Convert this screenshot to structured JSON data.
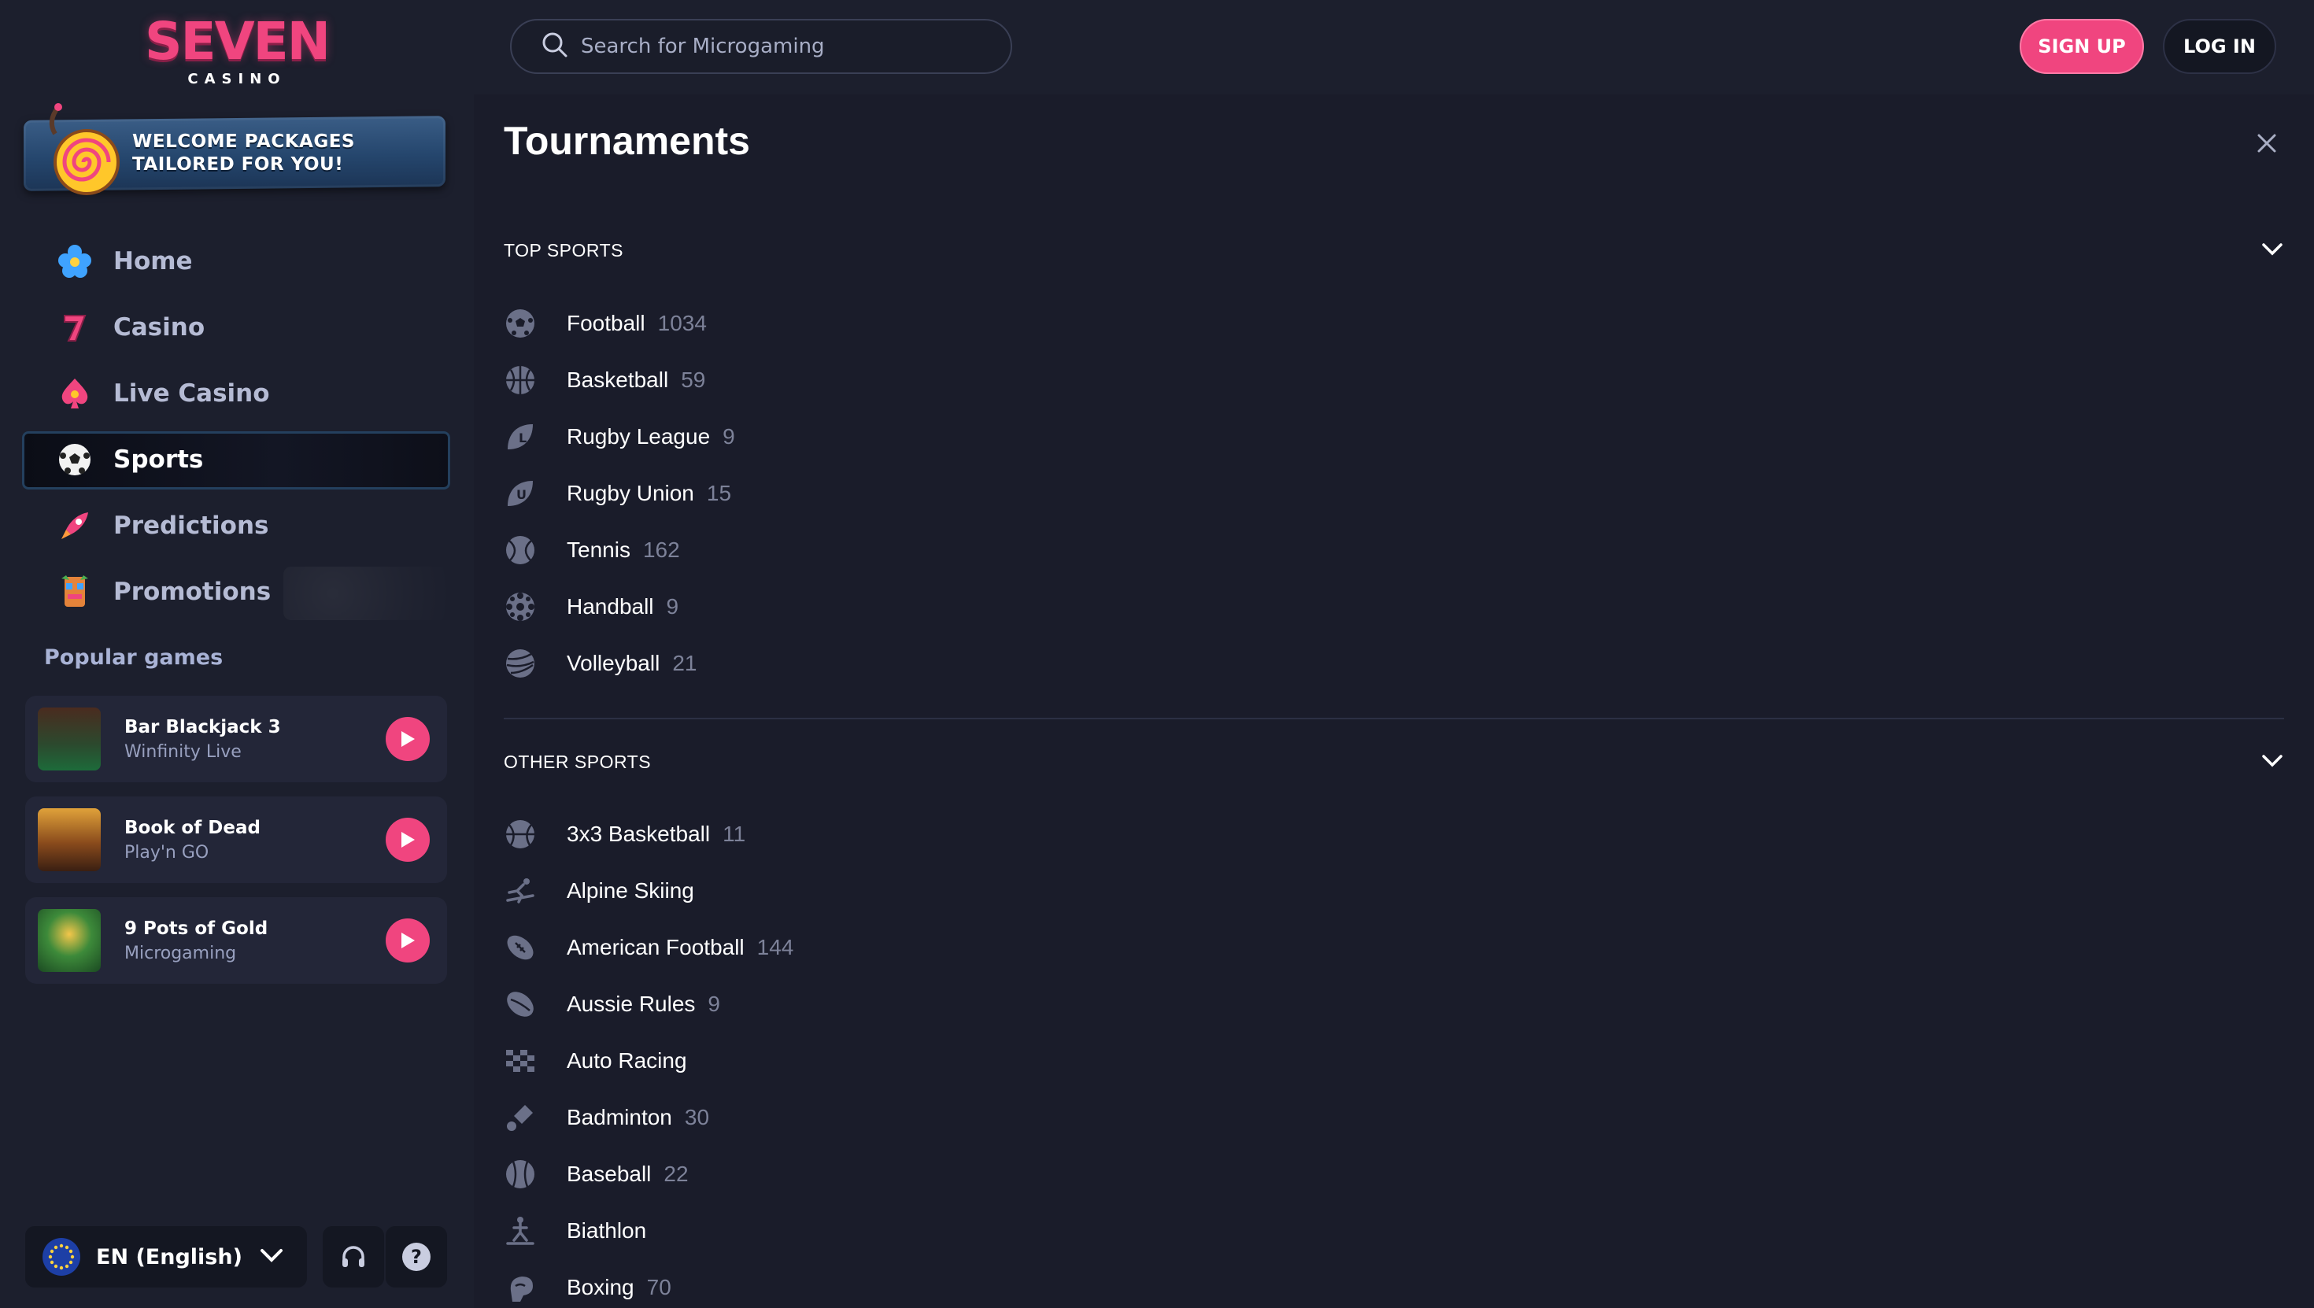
{
  "brand": {
    "logo_main": "SEVEN",
    "logo_sub": "CASINO"
  },
  "promo_banner": {
    "text": "WELCOME PACKAGES TAILORED FOR YOU!"
  },
  "nav": {
    "items": [
      {
        "label": "Home",
        "icon": "flower-icon"
      },
      {
        "label": "Casino",
        "icon": "seven-icon"
      },
      {
        "label": "Live Casino",
        "icon": "spade-icon"
      },
      {
        "label": "Sports",
        "icon": "soccer-ball-icon",
        "active": true
      },
      {
        "label": "Predictions",
        "icon": "rocket-icon"
      },
      {
        "label": "Promotions",
        "icon": "totem-icon"
      }
    ]
  },
  "popular_games": {
    "title": "Popular games",
    "games": [
      {
        "title": "Bar Blackjack 3",
        "provider": "Winfinity Live"
      },
      {
        "title": "Book of Dead",
        "provider": "Play'n GO"
      },
      {
        "title": "9 Pots of Gold",
        "provider": "Microgaming"
      }
    ]
  },
  "footer": {
    "language": "EN (English)"
  },
  "search": {
    "placeholder": "Search for Microgaming"
  },
  "auth": {
    "signup": "SIGN UP",
    "login": "LOG IN"
  },
  "panel": {
    "title": "Tournaments",
    "top_sports": {
      "label": "TOP SPORTS",
      "items": [
        {
          "name": "Football",
          "count": "1034",
          "icon": "football-icon"
        },
        {
          "name": "Basketball",
          "count": "59",
          "icon": "basketball-icon"
        },
        {
          "name": "Rugby League",
          "count": "9",
          "icon": "rugby-league-icon"
        },
        {
          "name": "Rugby Union",
          "count": "15",
          "icon": "rugby-union-icon"
        },
        {
          "name": "Tennis",
          "count": "162",
          "icon": "tennis-icon"
        },
        {
          "name": "Handball",
          "count": "9",
          "icon": "handball-icon"
        },
        {
          "name": "Volleyball",
          "count": "21",
          "icon": "volleyball-icon"
        }
      ]
    },
    "other_sports": {
      "label": "OTHER SPORTS",
      "items": [
        {
          "name": "3x3 Basketball",
          "count": "11",
          "icon": "basketball-3x3-icon"
        },
        {
          "name": "Alpine Skiing",
          "count": "",
          "icon": "skiing-icon"
        },
        {
          "name": "American Football",
          "count": "144",
          "icon": "american-football-icon"
        },
        {
          "name": "Aussie Rules",
          "count": "9",
          "icon": "aussie-rules-icon"
        },
        {
          "name": "Auto Racing",
          "count": "",
          "icon": "checkered-flag-icon"
        },
        {
          "name": "Badminton",
          "count": "30",
          "icon": "shuttlecock-icon"
        },
        {
          "name": "Baseball",
          "count": "22",
          "icon": "baseball-icon"
        },
        {
          "name": "Biathlon",
          "count": "",
          "icon": "biathlon-icon"
        },
        {
          "name": "Boxing",
          "count": "70",
          "icon": "boxing-glove-icon"
        }
      ]
    }
  },
  "colors": {
    "accent": "#f0457f",
    "background": "#1a1c2a",
    "sidebar": "#1c1f2d",
    "muted": "#7d8299"
  }
}
